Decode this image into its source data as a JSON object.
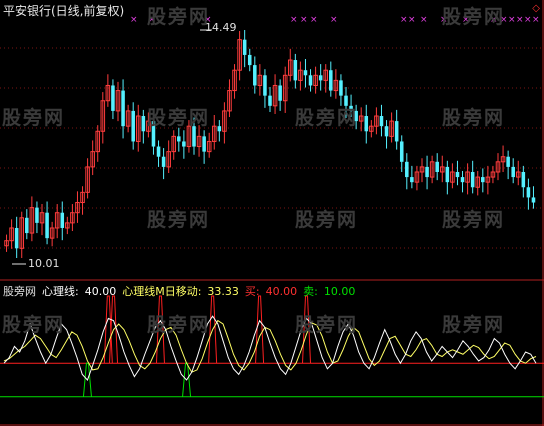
{
  "header": {
    "title": "平安银行(日线,前复权)"
  },
  "legend": {
    "name": "股旁网",
    "line1_label": "心理线:",
    "line1_value": "40.00",
    "line2_label": "心理线M日移动:",
    "line2_value": "33.33",
    "buy_label": "买:",
    "buy_value": "40.00",
    "sell_label": "卖:",
    "sell_value": "10.00"
  },
  "watermark_text": "股旁网",
  "top_marker": "◇",
  "colors": {
    "up": "#ff3d3d",
    "down": "#55f0ff",
    "line1": "#ffffff",
    "line2": "#ffff66",
    "buy": "#ff2020",
    "sell": "#00e000",
    "marker": "#e040e0"
  },
  "chart_data": [
    {
      "type": "candlestick",
      "title": "平安银行(日线,前复权)",
      "annotations": [
        {
          "label": "14.49",
          "kind": "max"
        },
        {
          "label": "10.01",
          "kind": "min"
        }
      ],
      "ylim": [
        10.01,
        14.49
      ],
      "closes": [
        10.35,
        10.6,
        10.2,
        10.8,
        10.5,
        11.0,
        10.7,
        10.9,
        10.4,
        10.6,
        10.9,
        10.6,
        10.7,
        10.9,
        11.1,
        11.3,
        11.8,
        12.1,
        12.5,
        13.1,
        13.4,
        12.9,
        13.3,
        12.6,
        12.9,
        12.3,
        12.8,
        12.5,
        12.7,
        12.2,
        12.0,
        11.8,
        12.1,
        12.4,
        12.3,
        12.2,
        12.6,
        12.2,
        12.4,
        12.1,
        12.3,
        12.6,
        12.5,
        12.9,
        13.3,
        13.7,
        14.3,
        14.0,
        13.8,
        13.4,
        13.6,
        13.2,
        13.0,
        13.4,
        13.1,
        13.6,
        13.9,
        13.5,
        13.7,
        13.6,
        13.4,
        13.6,
        13.5,
        13.7,
        13.3,
        13.5,
        13.2,
        13.0,
        12.9,
        12.7,
        12.8,
        12.5,
        12.6,
        12.8,
        12.6,
        12.4,
        12.7,
        12.3,
        11.9,
        11.6,
        11.5,
        11.7,
        11.8,
        11.6,
        11.9,
        11.7,
        11.8,
        11.5,
        11.7,
        11.6,
        11.5,
        11.7,
        11.4,
        11.6,
        11.5,
        11.6,
        11.7,
        11.9,
        12.0,
        11.8,
        11.6,
        11.7,
        11.4,
        11.2,
        11.1
      ]
    },
    {
      "type": "line",
      "series_names": [
        "心理线",
        "心理线M日移动",
        "买",
        "卖"
      ],
      "psy": [
        40,
        45,
        55,
        50,
        60,
        75,
        62,
        50,
        40,
        48,
        62,
        75,
        70,
        58,
        45,
        30,
        25,
        38,
        52,
        68,
        80,
        78,
        65,
        50,
        38,
        28,
        35,
        48,
        60,
        72,
        78,
        70,
        55,
        42,
        30,
        25,
        32,
        45,
        60,
        75,
        82,
        75,
        60,
        45,
        35,
        30,
        38,
        50,
        65,
        78,
        72,
        58,
        45,
        35,
        30,
        40,
        55,
        70,
        80,
        75,
        60,
        45,
        35,
        40,
        55,
        68,
        75,
        65,
        50,
        40,
        35,
        45,
        58,
        70,
        60,
        48,
        40,
        48,
        60,
        68,
        62,
        50,
        42,
        48,
        55,
        50,
        45,
        52,
        60,
        55,
        48,
        42,
        45,
        52,
        62,
        58,
        48,
        40,
        35,
        42,
        50,
        48,
        40
      ],
      "psy_ma": [
        42,
        44,
        48,
        52,
        55,
        60,
        65,
        62,
        55,
        48,
        45,
        52,
        60,
        68,
        65,
        55,
        42,
        34,
        35,
        45,
        58,
        70,
        75,
        70,
        60,
        48,
        38,
        35,
        40,
        50,
        62,
        70,
        72,
        65,
        52,
        40,
        32,
        34,
        44,
        58,
        70,
        78,
        75,
        62,
        48,
        38,
        34,
        40,
        50,
        64,
        72,
        70,
        60,
        48,
        38,
        34,
        40,
        52,
        66,
        76,
        74,
        64,
        50,
        40,
        42,
        52,
        64,
        72,
        68,
        56,
        44,
        38,
        42,
        52,
        62,
        64,
        56,
        48,
        46,
        52,
        60,
        62,
        56,
        48,
        46,
        50,
        52,
        50,
        48,
        52,
        56,
        54,
        48,
        44,
        46,
        52,
        58,
        56,
        48,
        42,
        40,
        44,
        46
      ]
    }
  ]
}
